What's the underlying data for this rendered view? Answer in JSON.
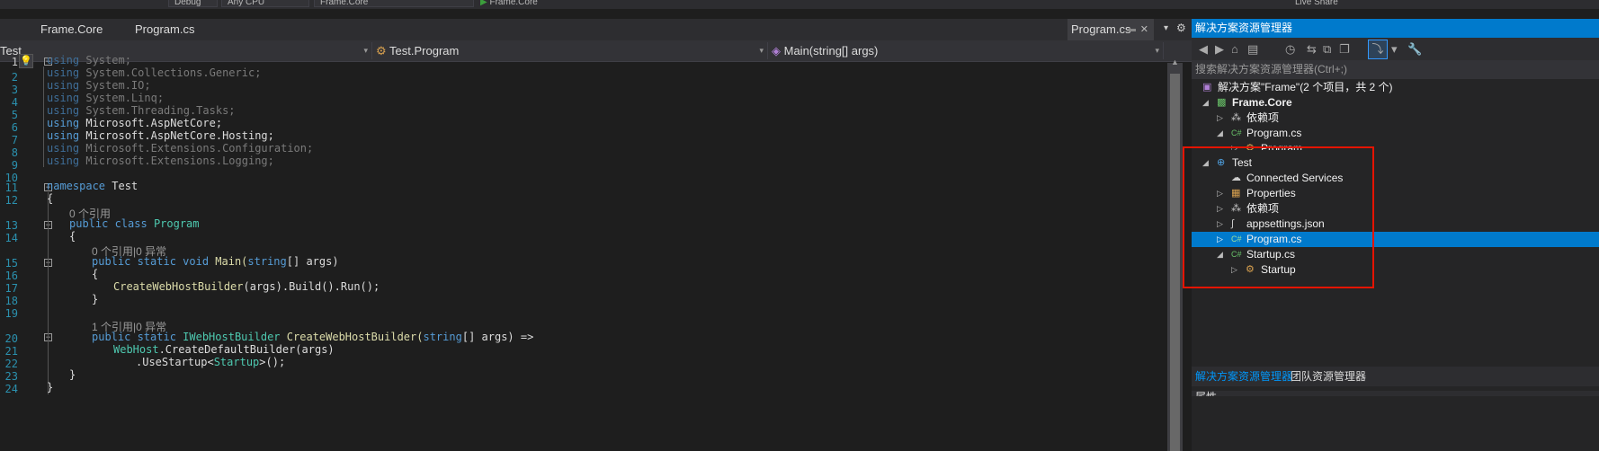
{
  "toolbar": {
    "config": "Debug",
    "platform": "Any CPU",
    "startup": "Frame.Core",
    "run_label": "Frame.Core",
    "live_share": "Live Share"
  },
  "editor_tabs": [
    {
      "label": "Frame.Core"
    },
    {
      "label": "Program.cs"
    }
  ],
  "active_doc_tab": "Program.cs",
  "navbar": {
    "project": "Test",
    "class": "Test.Program",
    "member": "Main(string[] args)"
  },
  "line_numbers": [
    "1",
    "2",
    "3",
    "4",
    "5",
    "6",
    "7",
    "8",
    "9",
    "10",
    "11",
    "12",
    "13",
    "14",
    "15",
    "16",
    "17",
    "18",
    "19",
    "20",
    "21",
    "22",
    "23",
    "24"
  ],
  "code": {
    "using_kw": "using",
    "u1": "System;",
    "u2": "System.Collections.Generic;",
    "u3": "System.IO;",
    "u4": "System.Linq;",
    "u5": "System.Threading.Tasks;",
    "u6": "Microsoft.AspNetCore;",
    "u7": "Microsoft.AspNetCore.Hosting;",
    "u8": "Microsoft.Extensions.Configuration;",
    "u9": "Microsoft.Extensions.Logging;",
    "namespace_kw": "namespace",
    "namespace_name": "Test",
    "brace_open": "{",
    "brace_close": "}",
    "lens_class": "0 个引用",
    "public_class": "public class",
    "class_name": "Program",
    "lens_main": "0 个引用|0 异常",
    "public_static_void": "public static void",
    "main_name": "Main(",
    "string_kw": "string",
    "main_args": "[] args)",
    "create_call": "CreateWebHostBuilder",
    "build_run": "(args).Build().Run();",
    "lens_create": "1 个引用|0 异常",
    "public_static": "public static",
    "iwhb": "IWebHostBuilder",
    "create_decl": "CreateWebHostBuilder(",
    "create_args": "[] args) =>",
    "webhost": "WebHost",
    "default_builder": ".CreateDefaultBuilder(args)",
    "use_startup": ".UseStartup<",
    "startup_type": "Startup",
    "use_startup_end": ">();"
  },
  "solution_explorer": {
    "title": "解决方案资源管理器",
    "search_placeholder": "搜索解决方案资源管理器(Ctrl+;)",
    "tree": [
      {
        "label": "解决方案\"Frame\"(2 个项目，共 2 个)"
      },
      {
        "label": "Frame.Core"
      },
      {
        "label": "依赖项"
      },
      {
        "label": "Program.cs"
      },
      {
        "label": "Program"
      },
      {
        "label": "Test"
      },
      {
        "label": "Connected Services"
      },
      {
        "label": "Properties"
      },
      {
        "label": "依赖项"
      },
      {
        "label": "appsettings.json"
      },
      {
        "label": "Program.cs"
      },
      {
        "label": "Startup.cs"
      },
      {
        "label": "Startup"
      }
    ],
    "bottom_tabs": [
      {
        "label": "解决方案资源管理器"
      },
      {
        "label": "团队资源管理器"
      }
    ],
    "properties_label": "属性"
  },
  "colors": {
    "accent": "#007acc",
    "highlight_box": "#e51400"
  }
}
